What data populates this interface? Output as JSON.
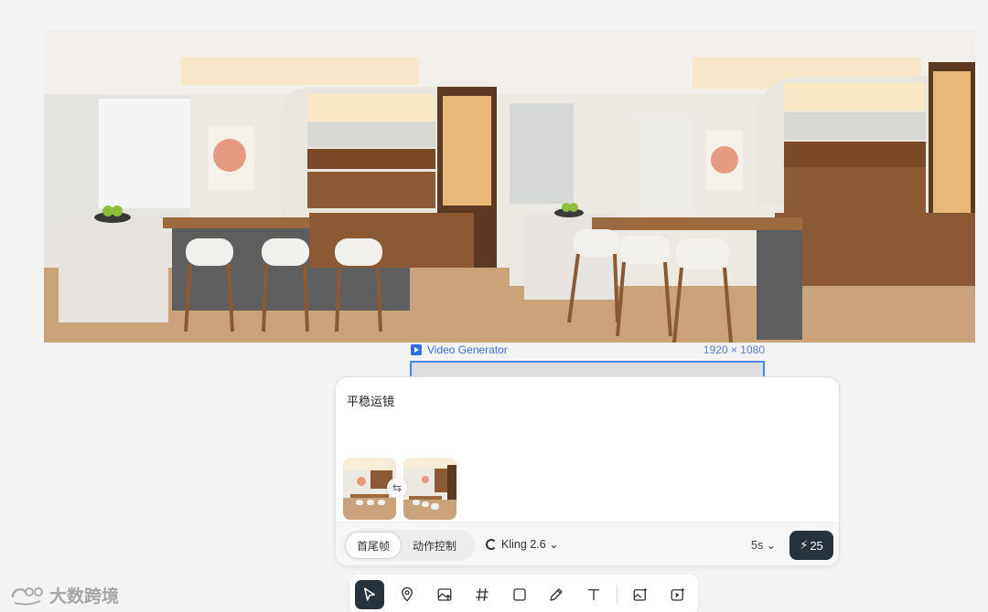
{
  "generator": {
    "title": "Video Generator",
    "size": "1920 × 1080"
  },
  "prompt": {
    "text": "平稳运镜"
  },
  "footer": {
    "mode_first_last": "首尾帧",
    "mode_motion": "动作控制",
    "model": "Kling 2.6 ⌄",
    "duration": "5s ⌄",
    "credits": "25"
  },
  "toolbar": {
    "tools": [
      "select-tool",
      "location-tool",
      "image-tool",
      "grid-tool",
      "rectangle-tool",
      "pen-tool",
      "text-tool",
      "image-generate-tool",
      "video-generate-tool"
    ]
  },
  "watermark": {
    "text": "大数跨境"
  },
  "colors": {
    "accent": "#2f6ee0",
    "dark_button": "#26323c",
    "wood": "#8a5a35"
  }
}
